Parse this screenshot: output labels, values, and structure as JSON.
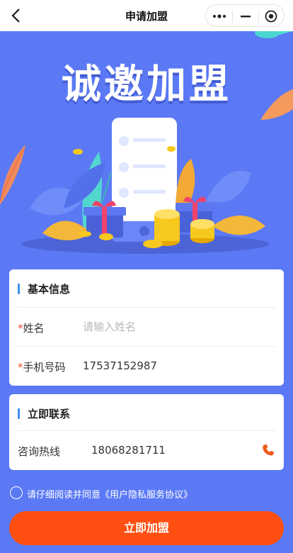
{
  "navbar": {
    "title": "申请加盟",
    "back_icon": "chevron-left-icon",
    "more_icon": "more-dots-icon",
    "minimize_icon": "minimize-icon",
    "close_icon": "target-close-icon"
  },
  "hero": {
    "title": "诚邀加盟"
  },
  "basic_info": {
    "title": "基本信息",
    "name_required": "*",
    "name_label": "姓名",
    "name_placeholder": "请输入姓名",
    "name_value": "",
    "phone_required": "*",
    "phone_label": "手机号码",
    "phone_value": "17537152987"
  },
  "contact": {
    "title": "立即联系",
    "hotline_label": "咨询热线",
    "hotline_value": "18068281711",
    "phone_icon": "phone-icon"
  },
  "agreement": {
    "text": "请仔细阅读并同意《用户隐私服务协议》",
    "checked": false
  },
  "submit": {
    "label": "立即加盟"
  },
  "colors": {
    "background": "#5b79f5",
    "accent_orange": "#ff4f12",
    "section_bar": "#3c8ff0",
    "required": "#f14b2c"
  }
}
